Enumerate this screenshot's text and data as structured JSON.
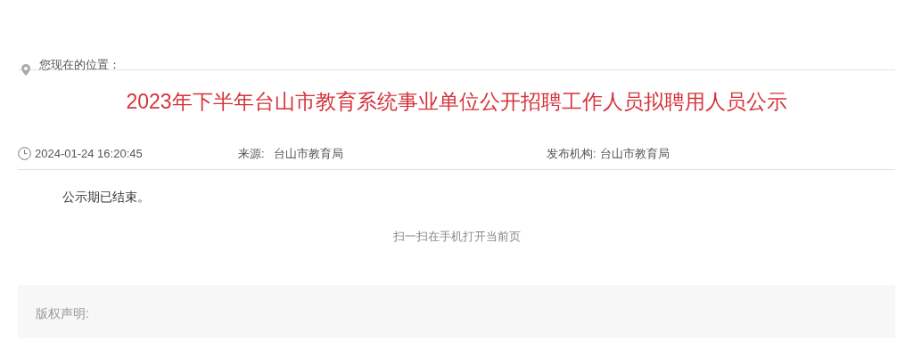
{
  "breadcrumb": {
    "label": "您现在的位置："
  },
  "article": {
    "title": "2023年下半年台山市教育系统事业单位公开招聘工作人员拟聘用人员公示",
    "meta": {
      "time": "2024-01-24 16:20:45",
      "source_label": "来源:",
      "source": "台山市教育局",
      "publisher_label": "发布机构:",
      "publisher": "台山市教育局"
    },
    "body": "公示期已结束。",
    "qr_caption": "扫一扫在手机打开当前页"
  },
  "copyright": {
    "label": "版权声明:"
  }
}
